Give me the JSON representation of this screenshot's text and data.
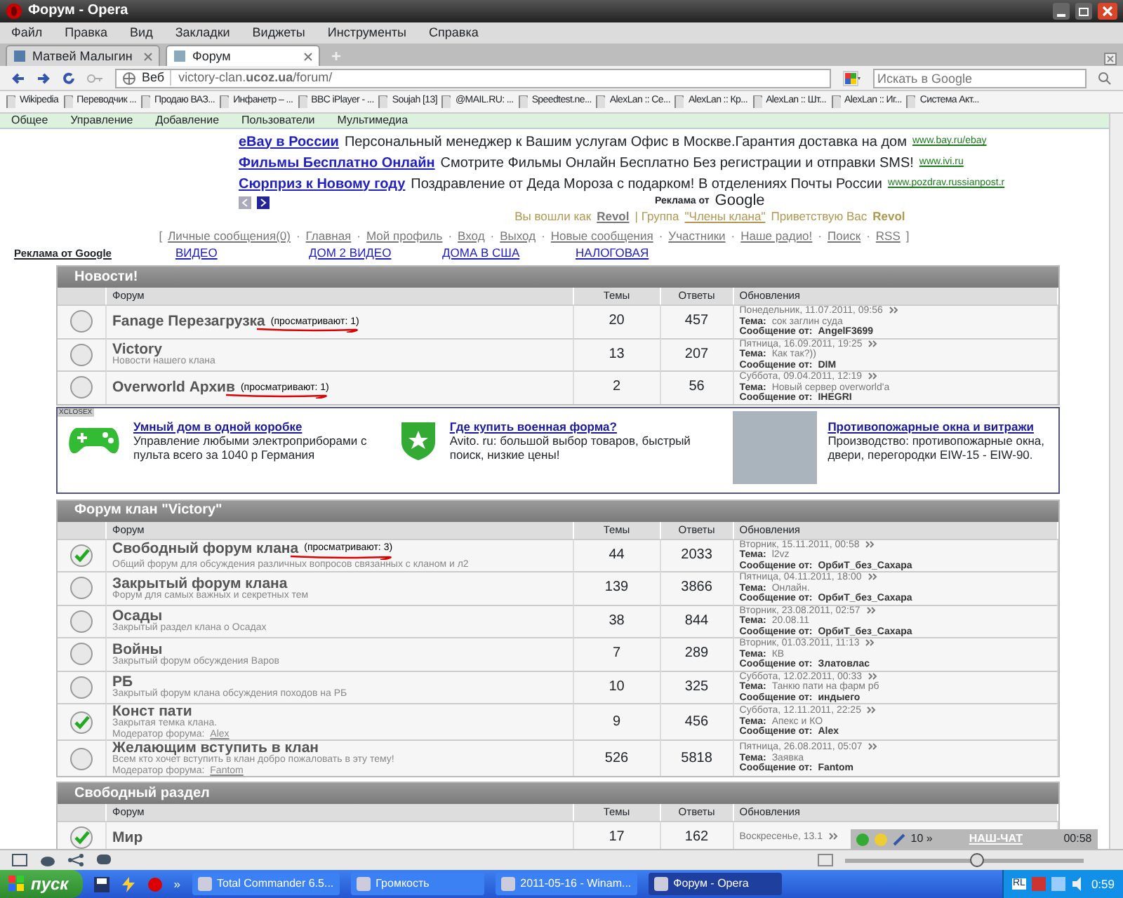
{
  "window": {
    "title": "Форум - Opera"
  },
  "menu": [
    "Файл",
    "Правка",
    "Вид",
    "Закладки",
    "Виджеты",
    "Инструменты",
    "Справка"
  ],
  "tabs": [
    {
      "label": "Матвей Малыгин",
      "selected": false
    },
    {
      "label": "Форум",
      "selected": true
    }
  ],
  "new_tab": "+",
  "address": {
    "label": "Веб",
    "url": "victory-clan.**ucoz.ua**/forum/"
  },
  "search": {
    "placeholder": "Искать в Google"
  },
  "bookmarks": [
    "Wikipedia",
    "Переводчик ...",
    "Продаю ВАЗ...",
    "Инфанетр – ...",
    "BBC iPlayer - ...",
    "Soujah [13]",
    "@MAIL.RU: ...",
    "Speedtest.ne...",
    "AlexLan :: Се...",
    "AlexLan :: Кр...",
    "AlexLan :: Шт...",
    "AlexLan :: Иг...",
    "Система Акт..."
  ],
  "admin_bar": [
    "Общее",
    "Управление",
    "Добавление",
    "Пользователи",
    "Мультимедиа"
  ],
  "top_ads": [
    {
      "title": "eBay в России",
      "text": "Персональный менеджер к Вашим услугам Офис в Москве.Гарантия доставка на дом",
      "url": "www.bay.ru/ebay"
    },
    {
      "title": "Фильмы Бесплатно Онлайн",
      "text": "Смотрите Фильмы Онлайн Бесплатно Без регистрации и отправки SMS!",
      "url": "www.ivi.ru"
    },
    {
      "title": "Сюрприз к Новому году",
      "text": "Поздравление от Деда Мороза с подарком! В отделениях Почты России",
      "url": "www.pozdrav.russianpost.r"
    }
  ],
  "ads_by": "Реклама от",
  "ads_brand": "Google",
  "welcome": {
    "prefix": "Вы вошли как",
    "user": "Revol",
    "group_label": "| Группа",
    "group": "\"Члены клана\"",
    "greeting": "Приветствую Вас",
    "greet_user": "Revol"
  },
  "nav": {
    "open": "[",
    "close": "]",
    "separator": "·",
    "links": [
      "Личные сообщения(0)",
      "Главная",
      "Мой профиль",
      "Вход",
      "Выход",
      "Новые сообщения",
      "Участники",
      "Наше радио!",
      "Поиск",
      "RSS"
    ]
  },
  "ad_links": {
    "label": "Реклама от Google",
    "links": [
      "ВИДЕО",
      "ДОМ 2 ВИДЕО",
      "ДОМА В США",
      "НАЛОГОВАЯ"
    ]
  },
  "sections": [
    {
      "title": "Новости!",
      "columns": [
        "Форум",
        "Темы",
        "Ответы",
        "Обновления"
      ],
      "rows": [
        {
          "has_new": false,
          "title": "Fanage Перезагрузка",
          "viewers": "(просматривают: 1)",
          "topics": "20",
          "replies": "457",
          "date": "Понедельник, 11.07.2011, 09:56",
          "topic_label": "Тема:",
          "topic": "сок заглин суда",
          "author_label": "Сообщение от:",
          "author": "AngelF3699"
        },
        {
          "has_new": false,
          "title": "Victory",
          "description": "Новости нашего клана",
          "topics": "13",
          "replies": "207",
          "date": "Пятница, 16.09.2011, 19:25",
          "topic_label": "Тема:",
          "topic": "Как так?))",
          "author_label": "Сообщение от:",
          "author": "DIM"
        },
        {
          "has_new": false,
          "title": "Overworld Архив",
          "viewers": "(просматривают: 1)",
          "topics": "2",
          "replies": "56",
          "date": "Суббота, 09.04.2011, 12:19",
          "topic_label": "Тема:",
          "topic": "Новый сервер overworld'a",
          "author_label": "Сообщение от:",
          "author": "IHEGRI"
        }
      ]
    },
    {
      "title": "Форум клан \"Victory\"",
      "columns": [
        "Форум",
        "Темы",
        "Ответы",
        "Обновления"
      ],
      "rows": [
        {
          "has_new": true,
          "title": "Свободный форум клана",
          "viewers": "(просматривают: 3)",
          "description": "Общий форум для обсуждения различных вопросов связанных с кланом и л2",
          "topics": "44",
          "replies": "2033",
          "date": "Вторник, 15.11.2011, 00:58",
          "topic_label": "Тема:",
          "topic": "l2vz",
          "author_label": "Сообщение от:",
          "author": "ОрбиТ_без_Сахара"
        },
        {
          "has_new": false,
          "title": "Закрытый форум клана",
          "description": "Форум для самых важных и секретных тем",
          "topics": "139",
          "replies": "3866",
          "date": "Пятница, 04.11.2011, 18:00",
          "topic_label": "Тема:",
          "topic": "Онлайн.",
          "author_label": "Сообщение от:",
          "author": "ОрбиТ_без_Сахара"
        },
        {
          "has_new": false,
          "title": "Осады",
          "description": "Закрытый раздел клана о Осадах",
          "topics": "38",
          "replies": "844",
          "date": "Вторник, 23.08.2011, 02:57",
          "topic_label": "Тема:",
          "topic": "20.08.11",
          "author_label": "Сообщение от:",
          "author": "ОрбиТ_без_Сахара"
        },
        {
          "has_new": false,
          "title": "Войны",
          "description": "Закрытый форум обсуждения Варов",
          "topics": "7",
          "replies": "289",
          "date": "Вторник, 01.03.2011, 11:13",
          "topic_label": "Тема:",
          "topic": "КВ",
          "author_label": "Сообщение от:",
          "author": "Златовлас"
        },
        {
          "has_new": false,
          "title": "РБ",
          "description": "Закрытый форум клана обсуждения походов на РБ",
          "topics": "10",
          "replies": "325",
          "date": "Суббота, 12.02.2011, 00:33",
          "topic_label": "Тема:",
          "topic": "Танкю пати на фарм рб",
          "author_label": "Сообщение от:",
          "author": "индыего"
        },
        {
          "has_new": true,
          "title": "Конст пати",
          "description": "Закрытая темка клана.",
          "moderator_label": "Модератор форума:",
          "moderator": "Alex",
          "topics": "9",
          "replies": "456",
          "date": "Суббота, 12.11.2011, 22:25",
          "topic_label": "Тема:",
          "topic": "Апекс и КО",
          "author_label": "Сообщение от:",
          "author": "Alex"
        },
        {
          "has_new": false,
          "title": "Желающим вступить в клан",
          "description": "Всем кто хочет вступить в клан добро пожаловать в эту тему!",
          "moderator_label": "Модератор форума:",
          "moderator": "Fantom",
          "topics": "526",
          "replies": "5818",
          "date": "Пятница, 26.08.2011, 05:07",
          "topic_label": "Тема:",
          "topic": "Заявка",
          "author_label": "Сообщение от:",
          "author": "Fantom"
        }
      ]
    },
    {
      "title": "Свободный раздел",
      "columns": [
        "Форум",
        "Темы",
        "Ответы",
        "Обновления"
      ],
      "rows": [
        {
          "has_new": true,
          "title": "Мир",
          "topics": "17",
          "replies": "162",
          "date": "Воскресенье, 13.1"
        }
      ]
    }
  ],
  "mid_ads": {
    "close": "XCLOSEX",
    "items": [
      {
        "kind": "gamepad",
        "title": "Умный дом в одной коробке",
        "text": "Управление любыми электроприборами с пульта всего за 1040 р Германия"
      },
      {
        "kind": "shield",
        "title": "Где купить военная форма?",
        "text": "Avito. ru: большой выбор товаров, быстрый поиск, низкие цены!"
      },
      {
        "kind": "photo",
        "title": "Противопожарные окна и витражи",
        "text": "Производство: противопожарные окна, двери, перегородки EIW-15 - EIW-90."
      }
    ]
  },
  "chat": {
    "count": "10 »",
    "title": "НАШ-ЧАТ",
    "time": "00:58"
  },
  "zoom": {
    "level": 0.55
  },
  "taskbar": {
    "start": "пуск",
    "more": "»",
    "tasks": [
      {
        "label": "Total Commander 6.5...",
        "selected": false
      },
      {
        "label": "Громкость",
        "selected": false
      },
      {
        "label": "2011-05-16 - Winam...",
        "selected": false
      },
      {
        "label": "Форум - Opera",
        "selected": true
      }
    ],
    "lang": "RL",
    "clock": "0:59"
  }
}
